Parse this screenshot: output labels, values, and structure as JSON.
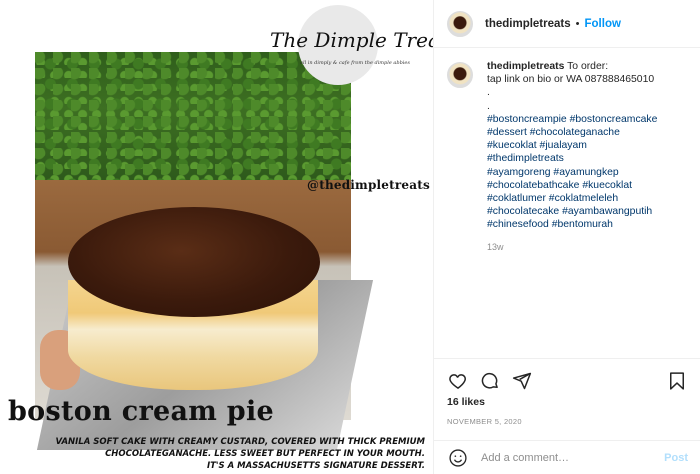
{
  "post": {
    "username": "thedimpletreats",
    "follow_label": "Follow",
    "separator": "•",
    "image": {
      "logo_text": "The Dimple Treats",
      "logo_subtext": "all in dimply & cafe from the dimple abbies",
      "watermark_handle": "@thedimpletreats",
      "title": "boston cream pie",
      "description_lines": [
        "VANILA SOFT CAKE WITH CREAMY CUSTARD, COVERED WITH THICK PREMIUM",
        "CHOCOLATEGANACHE. LESS SWEET BUT PERFECT IN YOUR MOUTH.",
        "IT'S A MASSACHUSETTS SIGNATURE DESSERT."
      ]
    },
    "caption": {
      "first_line_text": "To order:",
      "lines": [
        "tap link on bio or WA 087888465010",
        ".",
        ".",
        "#bostoncreampie #bostoncreamcake",
        "#dessert #chocolateganache",
        "#kuecoklat #jualayam",
        "#thedimpletreats",
        "#ayamgoreng #ayamungkep",
        "#chocolatebathcake #kuecoklat",
        "#coklatlumer #coklatmeleleh",
        "#chocolatecake #ayambawangputih",
        "#chinesefood #bentomurah"
      ],
      "age": "13w"
    },
    "likes": "16 likes",
    "date": "NOVEMBER 5, 2020",
    "comment": {
      "placeholder": "Add a comment…",
      "post_label": "Post"
    },
    "icons": {
      "like": "heart-icon",
      "comment": "comment-icon",
      "share": "share-icon",
      "save": "bookmark-icon",
      "emoji": "emoji-icon"
    }
  }
}
